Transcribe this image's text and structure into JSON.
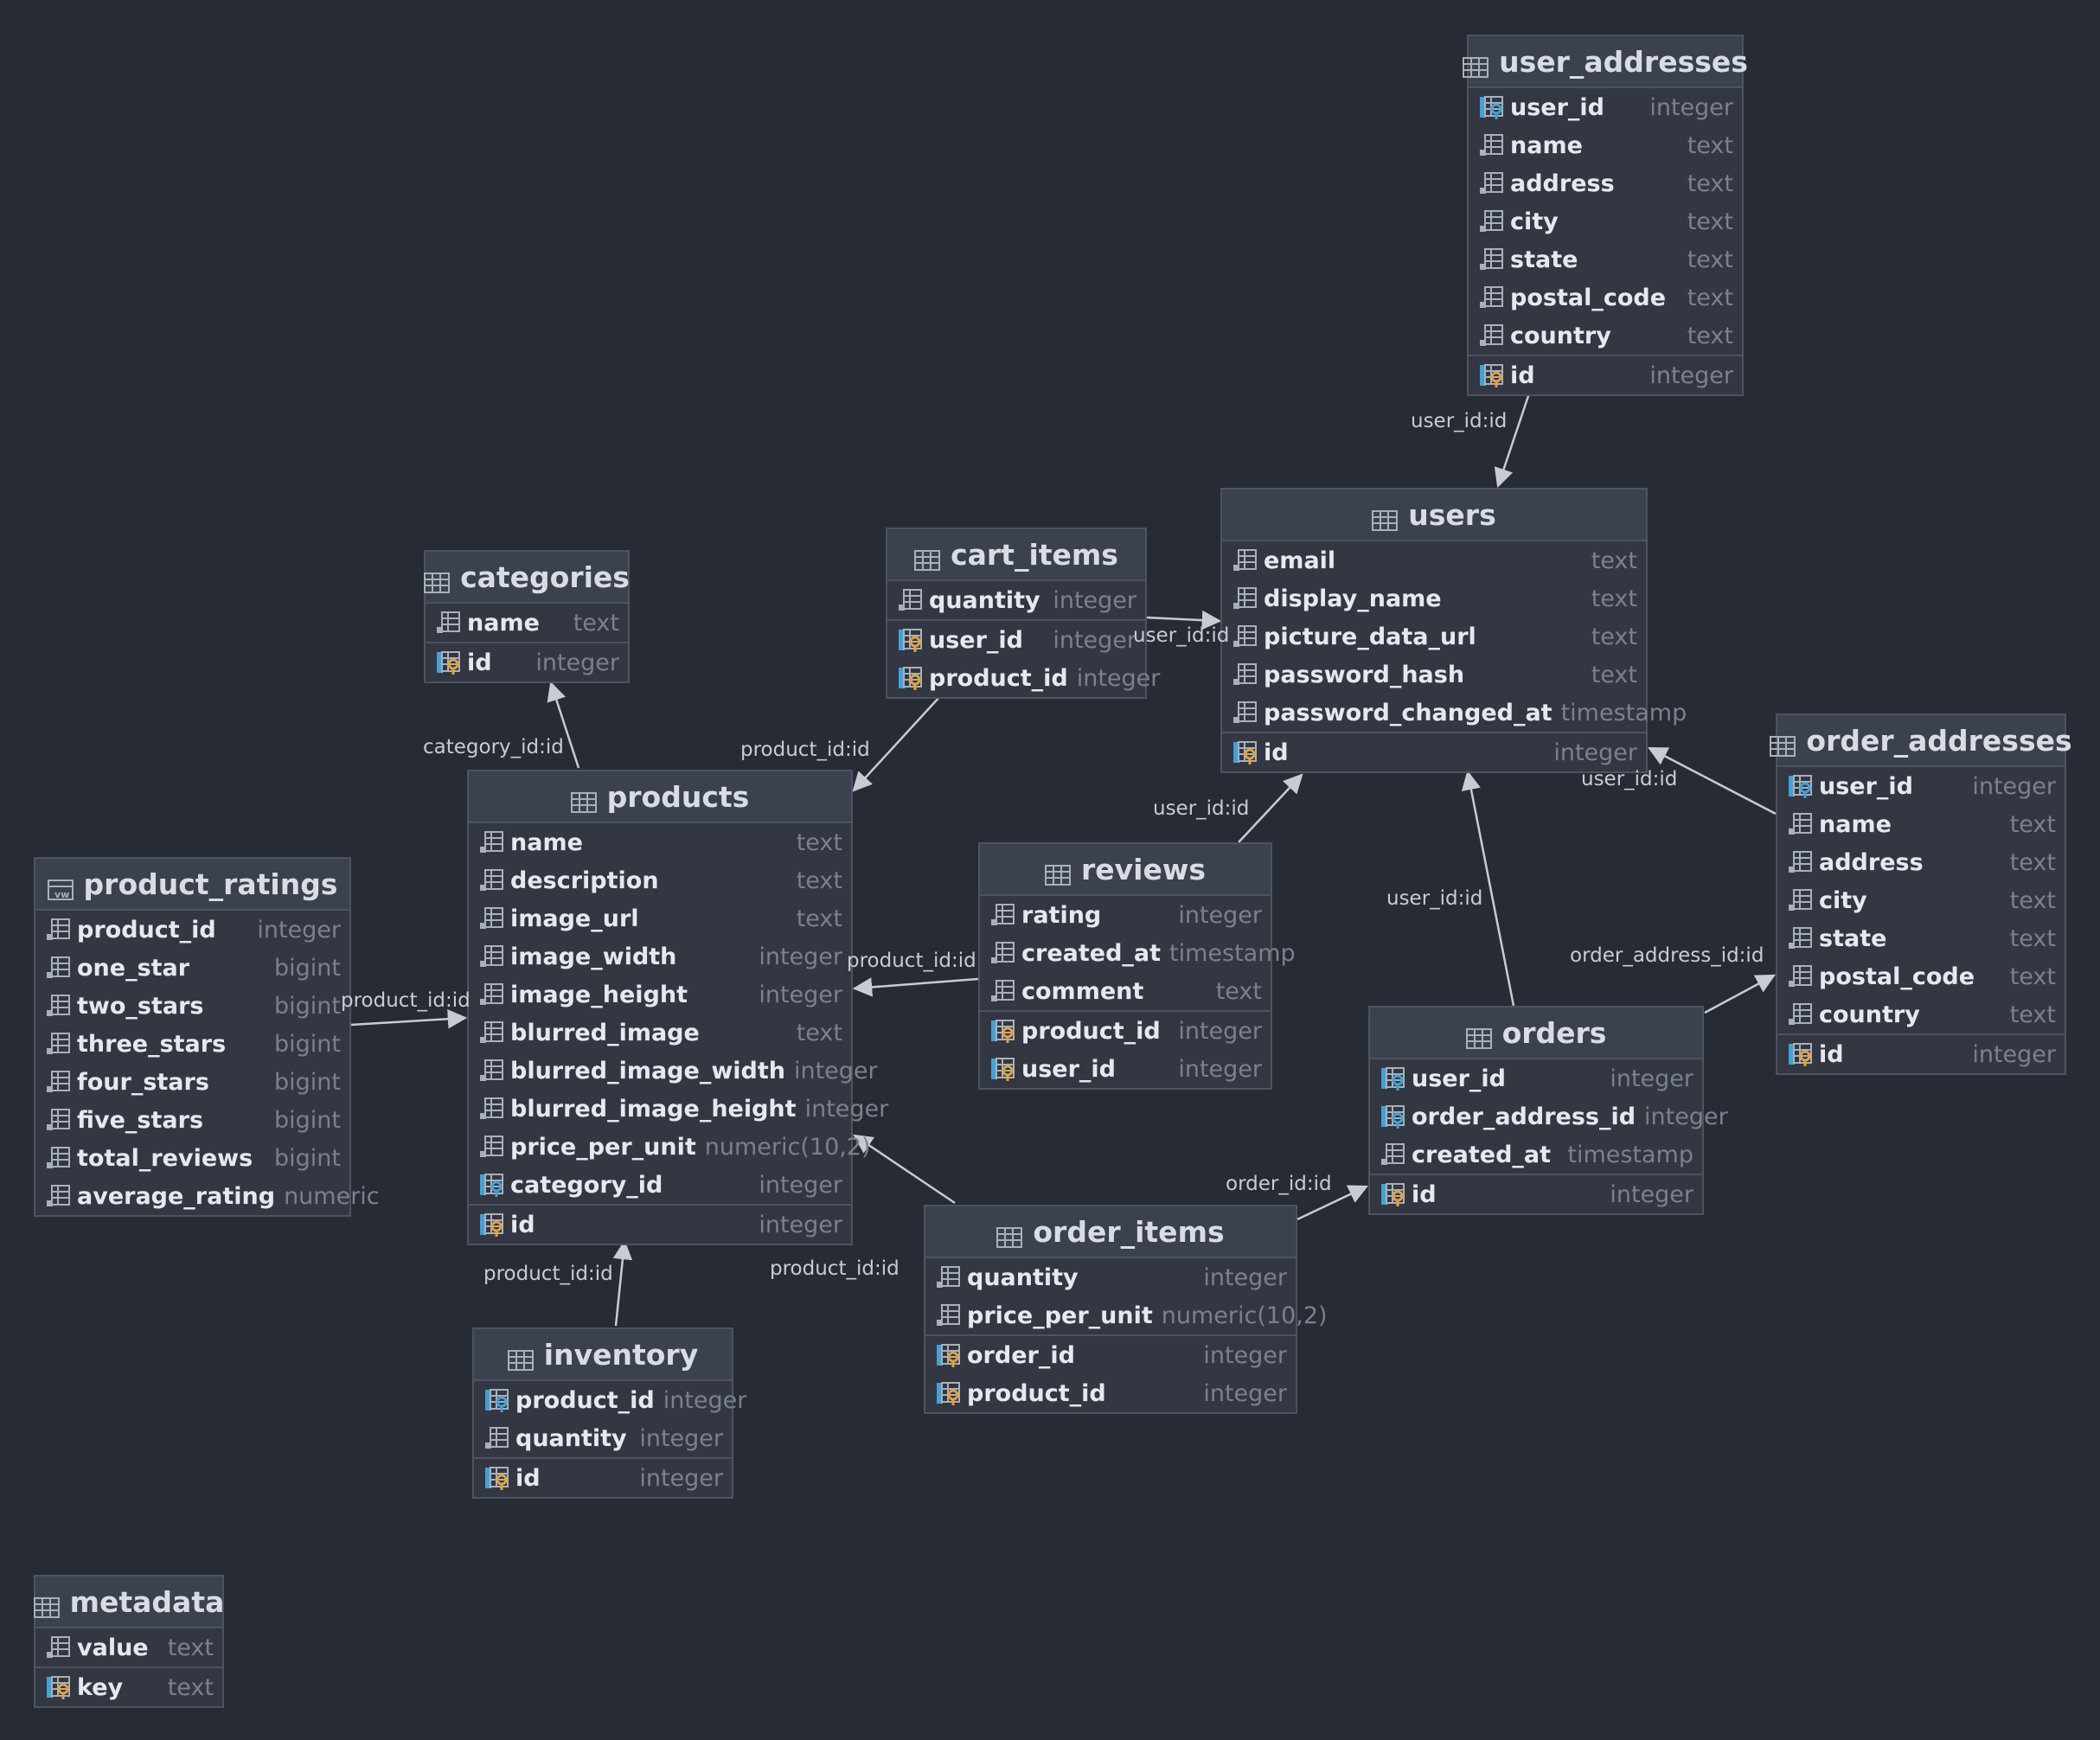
{
  "colors": {
    "background": "#272b33",
    "table_fill": "#323742",
    "table_header": "#3b414d",
    "border": "#4d5360",
    "type_text": "#7b818c",
    "key_blue": "#3fa3d8",
    "key_gold": "#e3a33a",
    "arrow": "#c8ccd2"
  },
  "tables": [
    {
      "id": "user_addresses",
      "name": "user_addresses",
      "icon": "table-icon",
      "columns": [
        {
          "name": "user_id",
          "type": "integer",
          "icon": "foreign-key-icon"
        },
        {
          "name": "name",
          "type": "text",
          "icon": "column-icon"
        },
        {
          "name": "address",
          "type": "text",
          "icon": "column-icon"
        },
        {
          "name": "city",
          "type": "text",
          "icon": "column-icon"
        },
        {
          "name": "state",
          "type": "text",
          "icon": "column-icon"
        },
        {
          "name": "postal_code",
          "type": "text",
          "icon": "column-icon"
        },
        {
          "name": "country",
          "type": "text",
          "icon": "column-icon"
        }
      ],
      "keys": [
        {
          "name": "id",
          "type": "integer",
          "icon": "primary-key-icon"
        }
      ]
    },
    {
      "id": "users",
      "name": "users",
      "icon": "table-icon",
      "columns": [
        {
          "name": "email",
          "type": "text",
          "icon": "column-icon"
        },
        {
          "name": "display_name",
          "type": "text",
          "icon": "column-icon"
        },
        {
          "name": "picture_data_url",
          "type": "text",
          "icon": "column-icon"
        },
        {
          "name": "password_hash",
          "type": "text",
          "icon": "column-icon"
        },
        {
          "name": "password_changed_at",
          "type": "timestamp",
          "icon": "column-icon"
        }
      ],
      "keys": [
        {
          "name": "id",
          "type": "integer",
          "icon": "primary-key-icon"
        }
      ]
    },
    {
      "id": "cart_items",
      "name": "cart_items",
      "icon": "table-icon",
      "columns": [
        {
          "name": "quantity",
          "type": "integer",
          "icon": "column-icon"
        }
      ],
      "keys": [
        {
          "name": "user_id",
          "type": "integer",
          "icon": "composite-key-icon"
        },
        {
          "name": "product_id",
          "type": "integer",
          "icon": "composite-key-icon"
        }
      ]
    },
    {
      "id": "categories",
      "name": "categories",
      "icon": "table-icon",
      "columns": [
        {
          "name": "name",
          "type": "text",
          "icon": "column-icon"
        }
      ],
      "keys": [
        {
          "name": "id",
          "type": "integer",
          "icon": "primary-key-icon"
        }
      ]
    },
    {
      "id": "products",
      "name": "products",
      "icon": "table-icon",
      "columns": [
        {
          "name": "name",
          "type": "text",
          "icon": "column-icon"
        },
        {
          "name": "description",
          "type": "text",
          "icon": "column-icon"
        },
        {
          "name": "image_url",
          "type": "text",
          "icon": "column-icon"
        },
        {
          "name": "image_width",
          "type": "integer",
          "icon": "column-icon"
        },
        {
          "name": "image_height",
          "type": "integer",
          "icon": "column-icon"
        },
        {
          "name": "blurred_image",
          "type": "text",
          "icon": "column-icon"
        },
        {
          "name": "blurred_image_width",
          "type": "integer",
          "icon": "column-icon"
        },
        {
          "name": "blurred_image_height",
          "type": "integer",
          "icon": "column-icon"
        },
        {
          "name": "price_per_unit",
          "type": "numeric(10,2)",
          "icon": "column-icon"
        },
        {
          "name": "category_id",
          "type": "integer",
          "icon": "foreign-key-icon"
        }
      ],
      "keys": [
        {
          "name": "id",
          "type": "integer",
          "icon": "primary-key-icon"
        }
      ]
    },
    {
      "id": "product_ratings",
      "name": "product_ratings",
      "icon": "view-icon",
      "columns": [
        {
          "name": "product_id",
          "type": "integer",
          "icon": "column-icon"
        },
        {
          "name": "one_star",
          "type": "bigint",
          "icon": "column-icon"
        },
        {
          "name": "two_stars",
          "type": "bigint",
          "icon": "column-icon"
        },
        {
          "name": "three_stars",
          "type": "bigint",
          "icon": "column-icon"
        },
        {
          "name": "four_stars",
          "type": "bigint",
          "icon": "column-icon"
        },
        {
          "name": "five_stars",
          "type": "bigint",
          "icon": "column-icon"
        },
        {
          "name": "total_reviews",
          "type": "bigint",
          "icon": "column-icon"
        },
        {
          "name": "average_rating",
          "type": "numeric",
          "icon": "column-icon"
        }
      ],
      "keys": []
    },
    {
      "id": "reviews",
      "name": "reviews",
      "icon": "table-icon",
      "columns": [
        {
          "name": "rating",
          "type": "integer",
          "icon": "column-icon"
        },
        {
          "name": "created_at",
          "type": "timestamp",
          "icon": "column-icon"
        },
        {
          "name": "comment",
          "type": "text",
          "icon": "column-icon"
        }
      ],
      "keys": [
        {
          "name": "product_id",
          "type": "integer",
          "icon": "composite-key-icon"
        },
        {
          "name": "user_id",
          "type": "integer",
          "icon": "composite-key-icon"
        }
      ]
    },
    {
      "id": "order_addresses",
      "name": "order_addresses",
      "icon": "table-icon",
      "columns": [
        {
          "name": "user_id",
          "type": "integer",
          "icon": "foreign-key-icon"
        },
        {
          "name": "name",
          "type": "text",
          "icon": "column-icon"
        },
        {
          "name": "address",
          "type": "text",
          "icon": "column-icon"
        },
        {
          "name": "city",
          "type": "text",
          "icon": "column-icon"
        },
        {
          "name": "state",
          "type": "text",
          "icon": "column-icon"
        },
        {
          "name": "postal_code",
          "type": "text",
          "icon": "column-icon"
        },
        {
          "name": "country",
          "type": "text",
          "icon": "column-icon"
        }
      ],
      "keys": [
        {
          "name": "id",
          "type": "integer",
          "icon": "primary-key-icon"
        }
      ]
    },
    {
      "id": "orders",
      "name": "orders",
      "icon": "table-icon",
      "columns": [
        {
          "name": "user_id",
          "type": "integer",
          "icon": "foreign-key-icon"
        },
        {
          "name": "order_address_id",
          "type": "integer",
          "icon": "foreign-key-icon"
        },
        {
          "name": "created_at",
          "type": "timestamp",
          "icon": "column-icon"
        }
      ],
      "keys": [
        {
          "name": "id",
          "type": "integer",
          "icon": "primary-key-icon"
        }
      ]
    },
    {
      "id": "order_items",
      "name": "order_items",
      "icon": "table-icon",
      "columns": [
        {
          "name": "quantity",
          "type": "integer",
          "icon": "column-icon"
        },
        {
          "name": "price_per_unit",
          "type": "numeric(10,2)",
          "icon": "column-icon"
        }
      ],
      "keys": [
        {
          "name": "order_id",
          "type": "integer",
          "icon": "composite-key-icon"
        },
        {
          "name": "product_id",
          "type": "integer",
          "icon": "composite-key-icon"
        }
      ]
    },
    {
      "id": "inventory",
      "name": "inventory",
      "icon": "table-icon",
      "columns": [
        {
          "name": "product_id",
          "type": "integer",
          "icon": "foreign-key-icon"
        },
        {
          "name": "quantity",
          "type": "integer",
          "icon": "column-icon"
        }
      ],
      "keys": [
        {
          "name": "id",
          "type": "integer",
          "icon": "primary-key-icon"
        }
      ]
    },
    {
      "id": "metadata",
      "name": "metadata",
      "icon": "table-icon",
      "columns": [
        {
          "name": "value",
          "type": "text",
          "icon": "column-icon"
        }
      ],
      "keys": [
        {
          "name": "key",
          "type": "text",
          "icon": "primary-key-icon"
        }
      ]
    }
  ],
  "relationships": [
    {
      "from": "user_addresses",
      "to": "users",
      "label": "user_id:id"
    },
    {
      "from": "cart_items",
      "to": "users",
      "label": "user_id:id"
    },
    {
      "from": "cart_items",
      "to": "products",
      "label": "product_id:id"
    },
    {
      "from": "products",
      "to": "categories",
      "label": "category_id:id"
    },
    {
      "from": "product_ratings",
      "to": "products",
      "label": "product_id:id"
    },
    {
      "from": "reviews",
      "to": "products",
      "label": "product_id:id"
    },
    {
      "from": "reviews",
      "to": "users",
      "label": "user_id:id"
    },
    {
      "from": "order_addresses",
      "to": "users",
      "label": "user_id:id"
    },
    {
      "from": "orders",
      "to": "users",
      "label": "user_id:id"
    },
    {
      "from": "orders",
      "to": "order_addresses",
      "label": "order_address_id:id"
    },
    {
      "from": "order_items",
      "to": "orders",
      "label": "order_id:id"
    },
    {
      "from": "order_items",
      "to": "products",
      "label": "product_id:id"
    },
    {
      "from": "inventory",
      "to": "products",
      "label": "product_id:id"
    }
  ]
}
